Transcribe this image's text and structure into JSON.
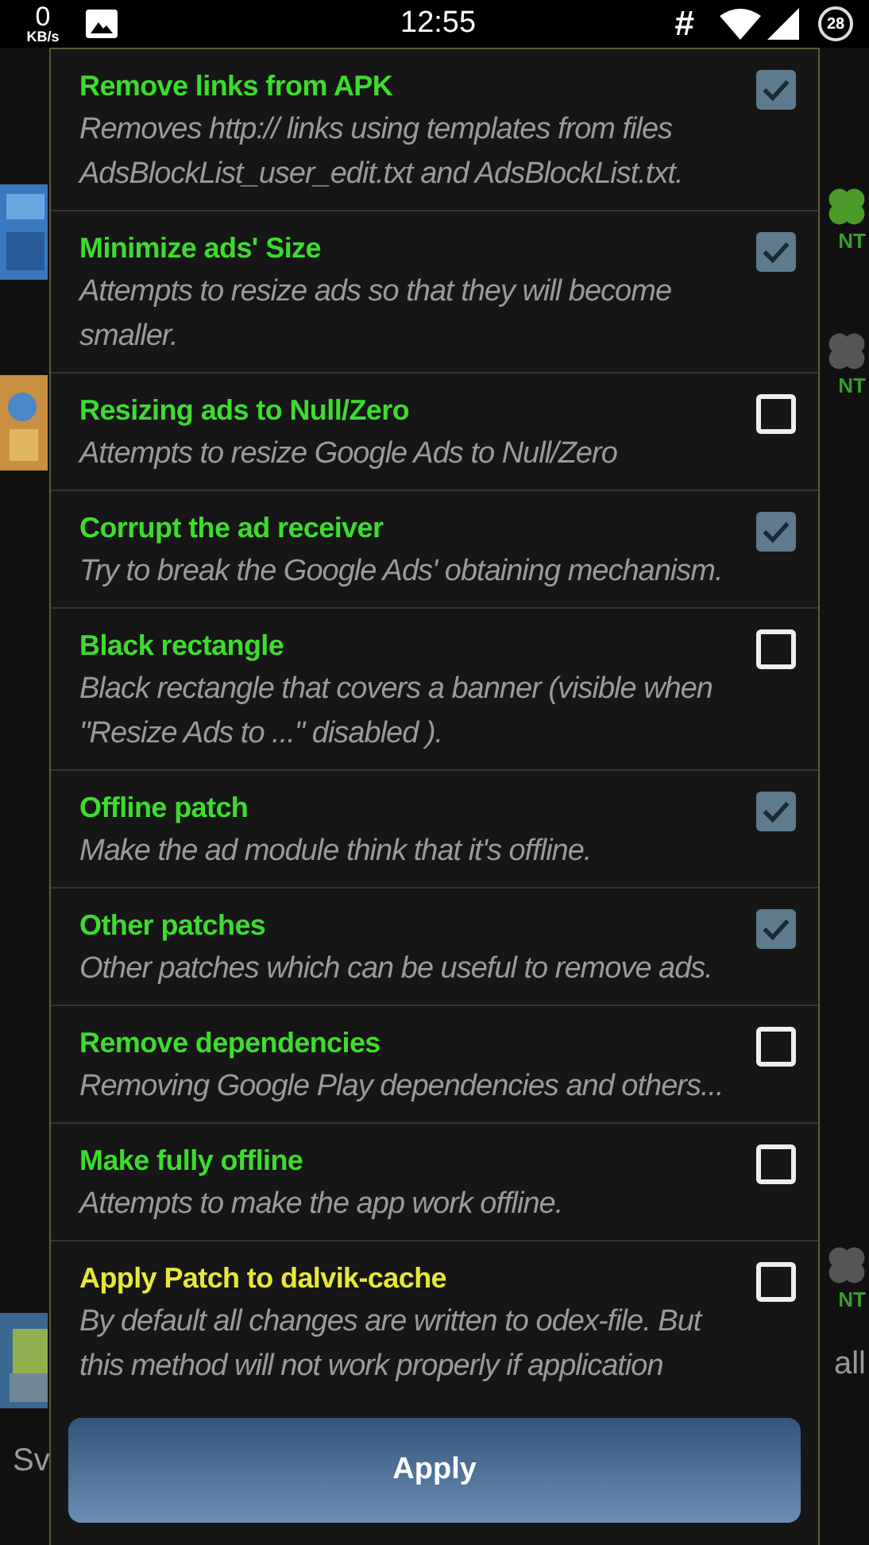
{
  "status_bar": {
    "speed": "0",
    "speed_unit": "KB/s",
    "time": "12:55",
    "hash": "#",
    "battery": "28"
  },
  "background": {
    "right_labels": [
      "NT",
      "NT",
      "NT"
    ],
    "bottom_left": "Sv",
    "bottom_right": "all"
  },
  "options": [
    {
      "title": "Remove links from APK",
      "description": "Removes http:// links using templates from files AdsBlockList_user_edit.txt and AdsBlockList.txt.",
      "checked": true,
      "color": "#3ddc2f"
    },
    {
      "title": "Minimize ads' Size",
      "description": "Attempts to resize ads so that they will become smaller.",
      "checked": true,
      "color": "#3ddc2f"
    },
    {
      "title": "Resizing ads to Null/Zero",
      "description": "Attempts to resize Google Ads to Null/Zero",
      "checked": false,
      "color": "#3ddc2f"
    },
    {
      "title": "Corrupt the ad receiver",
      "description": "Try to break the Google Ads' obtaining mechanism.",
      "checked": true,
      "color": "#3ddc2f"
    },
    {
      "title": "Black rectangle",
      "description": "Black rectangle that covers a banner (visible when \"Resize Ads to ...\" disabled ).",
      "checked": false,
      "color": "#3ddc2f"
    },
    {
      "title": "Offline patch",
      "description": "Make the ad module think that it's offline.",
      "checked": true,
      "color": "#3ddc2f"
    },
    {
      "title": "Other patches",
      "description": "Other patches which can be useful to remove ads.",
      "checked": true,
      "color": "#3ddc2f"
    },
    {
      "title": "Remove dependencies",
      "description": "Removing Google Play dependencies and others...",
      "checked": false,
      "color": "#3ddc2f"
    },
    {
      "title": "Make fully offline",
      "description": "Attempts to make the app work offline.",
      "checked": false,
      "color": "#3ddc2f"
    },
    {
      "title": "Apply Patch to dalvik-cache",
      "description": "By default all changes are written to odex-file. But this method will not work properly if application",
      "checked": false,
      "color": "#e8e83a"
    }
  ],
  "apply_button": "Apply"
}
